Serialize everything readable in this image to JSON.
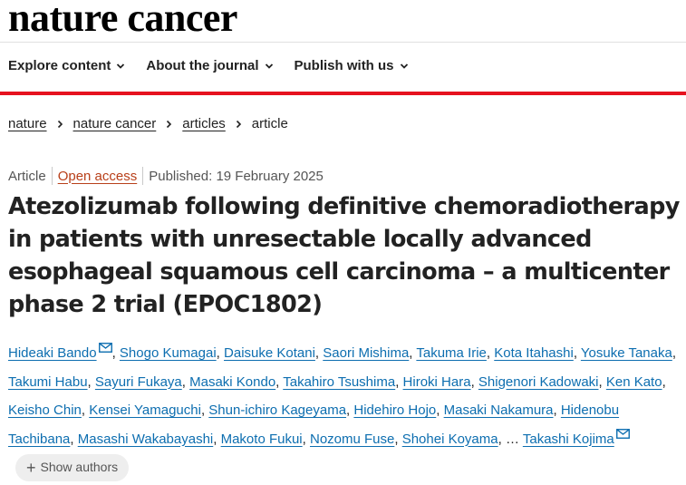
{
  "brand": {
    "logo_text": "nature cancer",
    "accent_color": "#e6121f",
    "link_color": "#0d6eb0",
    "oa_color": "#b83f19"
  },
  "nav": {
    "items": [
      {
        "label": "Explore content",
        "icon": "chevron-down-icon"
      },
      {
        "label": "About the journal",
        "icon": "chevron-down-icon"
      },
      {
        "label": "Publish with us",
        "icon": "chevron-down-icon"
      }
    ]
  },
  "breadcrumb": {
    "items": [
      "nature",
      "nature cancer",
      "articles"
    ],
    "current": "article"
  },
  "article": {
    "type": "Article",
    "access": "Open access",
    "published": "Published: 19 February 2025",
    "title": "Atezolizumab following definitive chemoradiotherapy in patients with unresectable locally advanced esophageal squamous cell carcinoma – a multicenter phase 2 trial (EPOC1802)"
  },
  "authors": {
    "list": [
      "Hideaki Bando",
      "Shogo Kumagai",
      "Daisuke Kotani",
      "Saori Mishima",
      "Takuma Irie",
      "Kota Itahashi",
      "Yosuke Tanaka",
      "Takumi Habu",
      "Sayuri Fukaya",
      "Masaki Kondo",
      "Takahiro Tsushima",
      "Hiroki Hara",
      "Shigenori Kadowaki",
      "Ken Kato",
      "Keisho Chin",
      "Kensei Yamaguchi",
      "Shun-ichiro Kageyama",
      "Hidehiro Hojo",
      "Masaki Nakamura",
      "Hidenobu Tachibana",
      "Masashi Wakabayashi",
      "Makoto Fukui",
      "Nozomu Fuse",
      "Shohei Koyama"
    ],
    "ellipsis": "…",
    "last": "Takashi Kojima",
    "show_authors_label": "Show authors"
  }
}
